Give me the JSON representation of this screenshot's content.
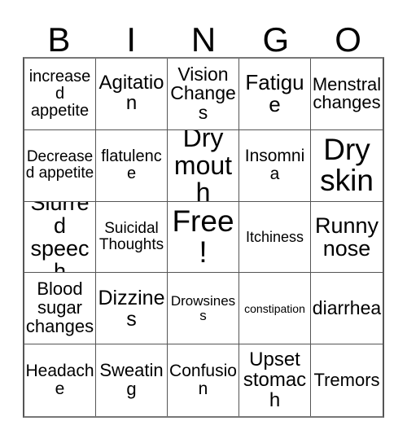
{
  "card": {
    "header_letters": [
      "B",
      "I",
      "N",
      "G",
      "O"
    ],
    "columns": 5,
    "rows": 5,
    "free_space_label": "Free!",
    "free_space_position": "center",
    "border_color": "#555555",
    "background_color": "#ffffff",
    "text_color": "#000000"
  },
  "cells": [
    {
      "text": "increased appetite",
      "size": "fs-20"
    },
    {
      "text": "Agitation",
      "size": "fs-24"
    },
    {
      "text": "Vision Changes",
      "size": "fs-23"
    },
    {
      "text": "Fatigue",
      "size": "fs-26"
    },
    {
      "text": "Menstral changes",
      "size": "fs-22"
    },
    {
      "text": "Decreased appetite",
      "size": "fs-19"
    },
    {
      "text": "flatulence",
      "size": "fs-20"
    },
    {
      "text": "Dry mouth",
      "size": "fs-32"
    },
    {
      "text": "Insomnia",
      "size": "fs-21"
    },
    {
      "text": "Dry skin",
      "size": "fs-37"
    },
    {
      "text": "Slurred speech",
      "size": "fs-27"
    },
    {
      "text": "Suicidal Thoughts",
      "size": "fs-19"
    },
    {
      "text": "Free!",
      "size": "fs-37"
    },
    {
      "text": "Itchiness",
      "size": "fs-18"
    },
    {
      "text": "Runny nose",
      "size": "fs-27"
    },
    {
      "text": "Blood sugar changes",
      "size": "fs-22"
    },
    {
      "text": "Dizzines",
      "size": "fs-25"
    },
    {
      "text": "Drowsiness",
      "size": "fs-17"
    },
    {
      "text": "constipation",
      "size": "fs-14"
    },
    {
      "text": "diarrhea",
      "size": "fs-23"
    },
    {
      "text": "Headache",
      "size": "fs-21"
    },
    {
      "text": "Sweating",
      "size": "fs-22"
    },
    {
      "text": "Confusion",
      "size": "fs-21"
    },
    {
      "text": "Upset stomach",
      "size": "fs-24"
    },
    {
      "text": "Tremors",
      "size": "fs-22"
    }
  ]
}
